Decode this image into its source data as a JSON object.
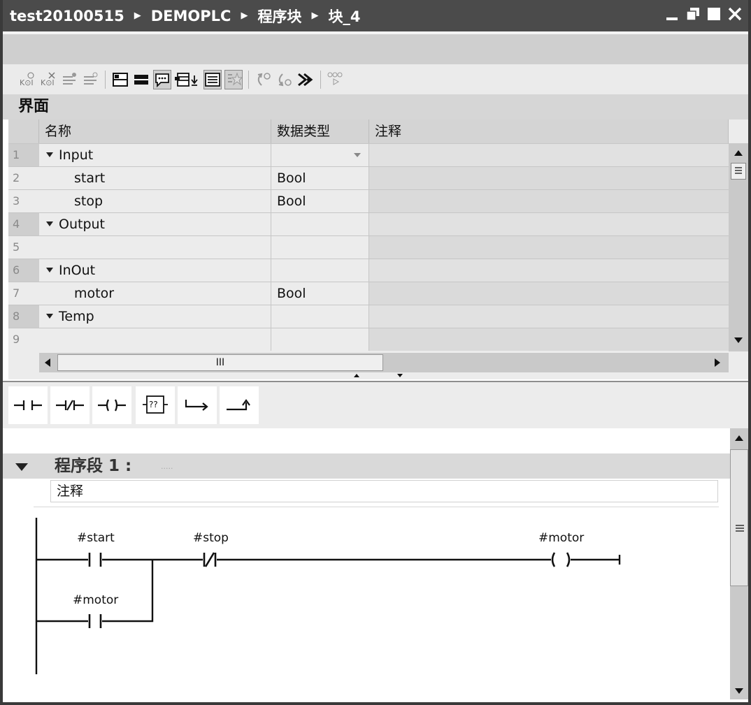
{
  "titlebar": {
    "crumbs": [
      "test20100515",
      "DEMOPLC",
      "程序块",
      "块_4"
    ],
    "buttons": [
      "minimize-icon",
      "restore-icon",
      "maximize-icon",
      "close-icon"
    ]
  },
  "interface": {
    "title": "界面",
    "columns": [
      "名称",
      "数据类型",
      "注释"
    ],
    "rows": [
      {
        "num": "1",
        "name": "Input",
        "type": "",
        "section": true
      },
      {
        "num": "2",
        "name": "start",
        "type": "Bool",
        "section": false
      },
      {
        "num": "3",
        "name": "stop",
        "type": "Bool",
        "section": false
      },
      {
        "num": "4",
        "name": "Output",
        "type": "",
        "section": true
      },
      {
        "num": "5",
        "name": "",
        "type": "",
        "section": false
      },
      {
        "num": "6",
        "name": "InOut",
        "type": "",
        "section": true
      },
      {
        "num": "7",
        "name": "motor",
        "type": "Bool",
        "section": false
      },
      {
        "num": "8",
        "name": "Temp",
        "type": "",
        "section": true
      },
      {
        "num": "9",
        "name": "",
        "type": "",
        "section": false
      }
    ],
    "hscroll_marker": "III"
  },
  "ladder_toolbar": {
    "items": [
      "normally-open-contact-icon",
      "normally-closed-contact-icon",
      "coil-icon",
      "empty-box-icon",
      "open-branch-icon",
      "close-branch-icon"
    ],
    "empty_box_label": "??"
  },
  "network": {
    "title": "程序段 1 :",
    "dots": ".....",
    "comment": "注释",
    "contact_start": "#start",
    "contact_stop": "#stop",
    "coil_motor": "#motor",
    "contact_motor": "#motor",
    "coil_glyph": "(  )"
  }
}
